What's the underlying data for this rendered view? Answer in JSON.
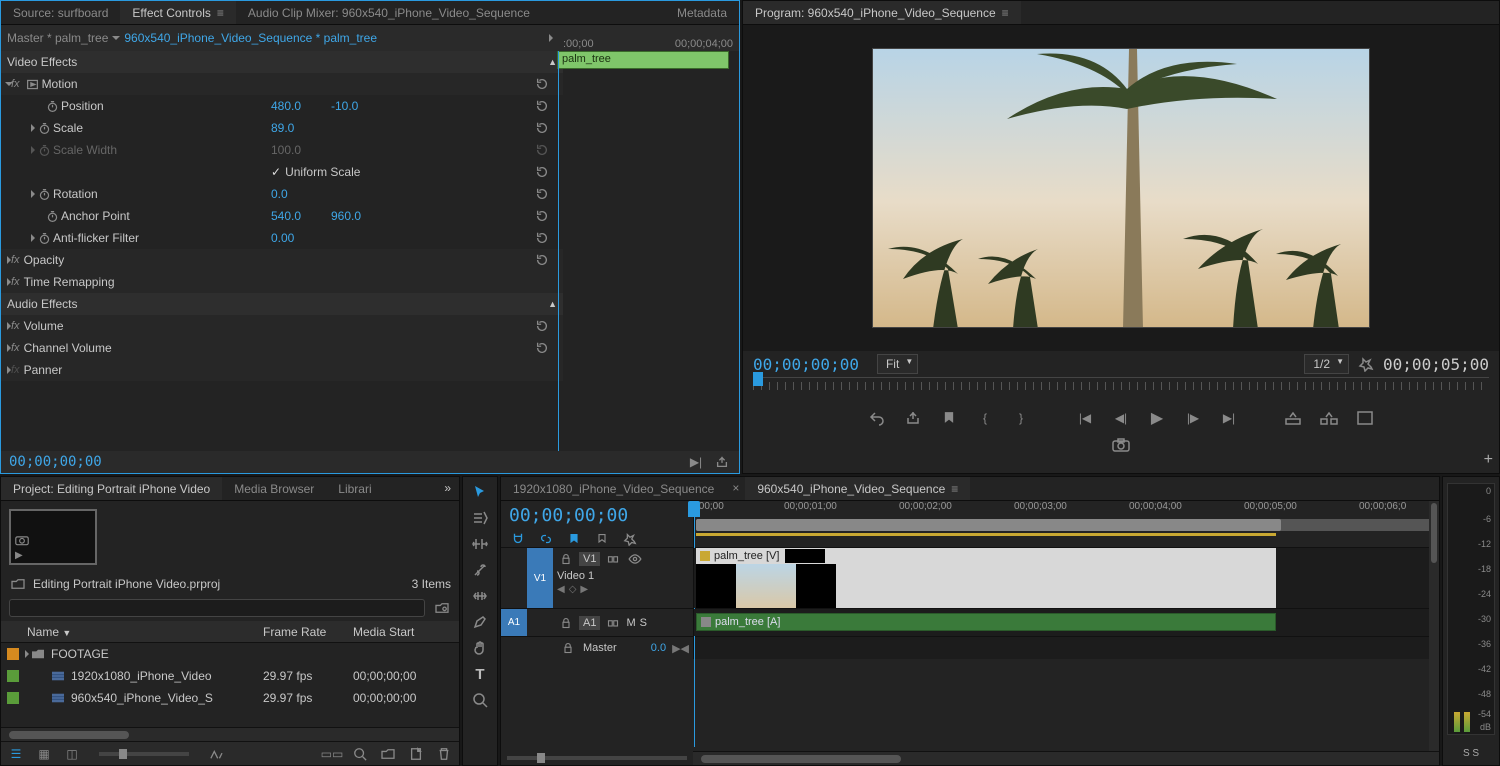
{
  "topTabs": {
    "source": "Source: surfboard",
    "effectControls": "Effect Controls",
    "audioMixer": "Audio Clip Mixer: 960x540_iPhone_Video_Sequence",
    "metadata": "Metadata"
  },
  "ec": {
    "masterPath": "Master * palm_tree",
    "seqPath": "960x540_iPhone_Video_Sequence * palm_tree",
    "tlStart": ":00;00",
    "tlEnd": "00;00;04;00",
    "clipName": "palm_tree",
    "videoEffectsHdr": "Video Effects",
    "motion": "Motion",
    "position": "Position",
    "posX": "480.0",
    "posY": "-10.0",
    "scale": "Scale",
    "scaleVal": "89.0",
    "scaleWidth": "Scale Width",
    "scaleWidthVal": "100.0",
    "uniform": "Uniform Scale",
    "rotation": "Rotation",
    "rotationVal": "0.0",
    "anchor": "Anchor Point",
    "anchorX": "540.0",
    "anchorY": "960.0",
    "antiflicker": "Anti-flicker Filter",
    "antiflickerVal": "0.00",
    "opacity": "Opacity",
    "timeRemap": "Time Remapping",
    "audioEffectsHdr": "Audio Effects",
    "volume": "Volume",
    "channelVolume": "Channel Volume",
    "panner": "Panner",
    "timecode": "00;00;00;00"
  },
  "program": {
    "title": "Program: 960x540_iPhone_Video_Sequence",
    "tcLeft": "00;00;00;00",
    "fit": "Fit",
    "zoom": "1/2",
    "tcRight": "00;00;05;00",
    "plus": "+"
  },
  "project": {
    "title": "Project: Editing Portrait iPhone Video",
    "mediaBrowser": "Media Browser",
    "libraries": "Librari",
    "binName": "Editing Portrait iPhone Video.prproj",
    "itemCount": "3 Items",
    "colName": "Name",
    "colFR": "Frame Rate",
    "colMS": "Media Start",
    "folder": "FOOTAGE",
    "seq1": "1920x1080_iPhone_Video",
    "seq2": "960x540_iPhone_Video_S",
    "fps": "29.97 fps",
    "start": "00;00;00;00"
  },
  "timeline": {
    "tab1": "1920x1080_iPhone_Video_Sequence",
    "tab2": "960x540_iPhone_Video_Sequence",
    "tc": "00;00;00;00",
    "ruler": [
      ":00;00",
      "00;00;01;00",
      "00;00;02;00",
      "00;00;03;00",
      "00;00;04;00",
      "00;00;05;00",
      "00;00;06;0"
    ],
    "v1": "V1",
    "video1": "Video 1",
    "a1": "A1",
    "master": "Master",
    "masterVal": "0.0",
    "clipV": "palm_tree [V]",
    "clipA": "palm_tree [A]",
    "mute": "M",
    "solo": "S"
  },
  "meter": {
    "db": [
      "0",
      "-6",
      "-12",
      "-18",
      "-24",
      "-30",
      "-36",
      "-42",
      "-48",
      "-54",
      "dB"
    ],
    "ss": "S  S"
  }
}
